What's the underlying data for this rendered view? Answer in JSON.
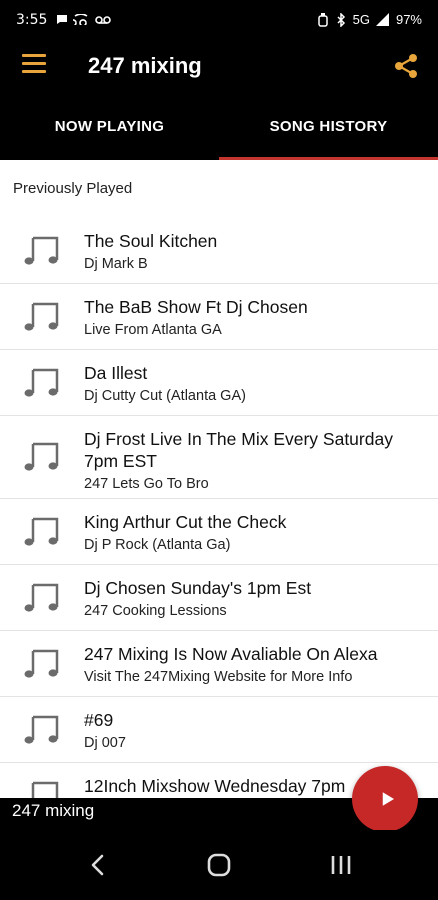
{
  "status_bar": {
    "time": "3:55",
    "left_icons": [
      "message-icon",
      "voicemail-icon",
      "missed-call-icon"
    ],
    "network": "5G",
    "battery": "97%"
  },
  "app_bar": {
    "title": "247 mixing",
    "accent_color": "#e7a53b"
  },
  "tabs": [
    {
      "label": "NOW PLAYING",
      "active": false
    },
    {
      "label": "SONG HISTORY",
      "active": true
    }
  ],
  "tab_indicator_color": "#c4352d",
  "history": {
    "section_label": "Previously Played",
    "items": [
      {
        "title": "The Soul Kitchen",
        "subtitle": "Dj Mark B"
      },
      {
        "title": "The BaB Show Ft Dj Chosen",
        "subtitle": "Live From Atlanta GA"
      },
      {
        "title": "Da Illest",
        "subtitle": "Dj Cutty Cut (Atlanta GA)"
      },
      {
        "title": "Dj Frost Live In The Mix Every Saturday 7pm EST",
        "subtitle": "247 Lets Go To Bro"
      },
      {
        "title": "King Arthur Cut the Check",
        "subtitle": "Dj P Rock (Atlanta Ga)"
      },
      {
        "title": "Dj Chosen Sunday's 1pm Est",
        "subtitle": "247 Cooking Lessions"
      },
      {
        "title": "247 Mixing Is Now Avaliable On Alexa",
        "subtitle": "Visit The 247Mixing Website for More Info"
      },
      {
        "title": "#69",
        "subtitle": "Dj 007"
      },
      {
        "title": "12Inch Mixshow Wednesday 7pm",
        "subtitle": ""
      }
    ]
  },
  "mini_player": {
    "title": "247 mixing",
    "play_button_color": "#c62828"
  },
  "nav_bar": {
    "buttons": [
      "back-icon",
      "home-icon",
      "recents-icon"
    ]
  }
}
